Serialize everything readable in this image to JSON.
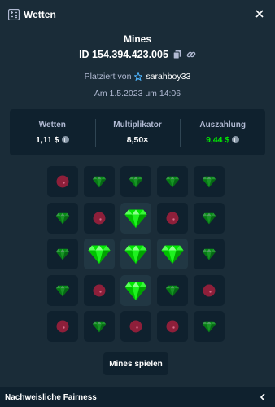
{
  "header": {
    "title": "Wetten"
  },
  "bet": {
    "game": "Mines",
    "id": "ID 154.394.423.005",
    "placed_by_prefix": "Platziert von",
    "user": "sarahboy33",
    "date": "Am 1.5.2023 um 14:06"
  },
  "stats": {
    "bet_label": "Wetten",
    "bet_value": "1,11 $",
    "multiplier_label": "Multiplikator",
    "multiplier_value": "8,50×",
    "payout_label": "Auszahlung",
    "payout_value": "9,44 $"
  },
  "board": {
    "rows": [
      [
        "mine",
        "gem",
        "gem",
        "gem",
        "gem"
      ],
      [
        "gem",
        "mine",
        "gem-picked",
        "mine",
        "gem"
      ],
      [
        "gem",
        "gem-picked",
        "gem-picked",
        "gem-picked",
        "gem"
      ],
      [
        "gem",
        "mine",
        "gem-picked",
        "gem",
        "mine"
      ],
      [
        "mine",
        "gem",
        "mine",
        "mine",
        "gem"
      ]
    ]
  },
  "actions": {
    "play_label": "Mines spielen"
  },
  "footer": {
    "fairness_label": "Nachweisliche Fairness"
  },
  "colors": {
    "background": "#1a2c38",
    "panel": "#0f212e",
    "tile": "#213743",
    "gem": "#00e701",
    "mine": "#8e1f3a",
    "muted_text": "#b1bad3"
  }
}
